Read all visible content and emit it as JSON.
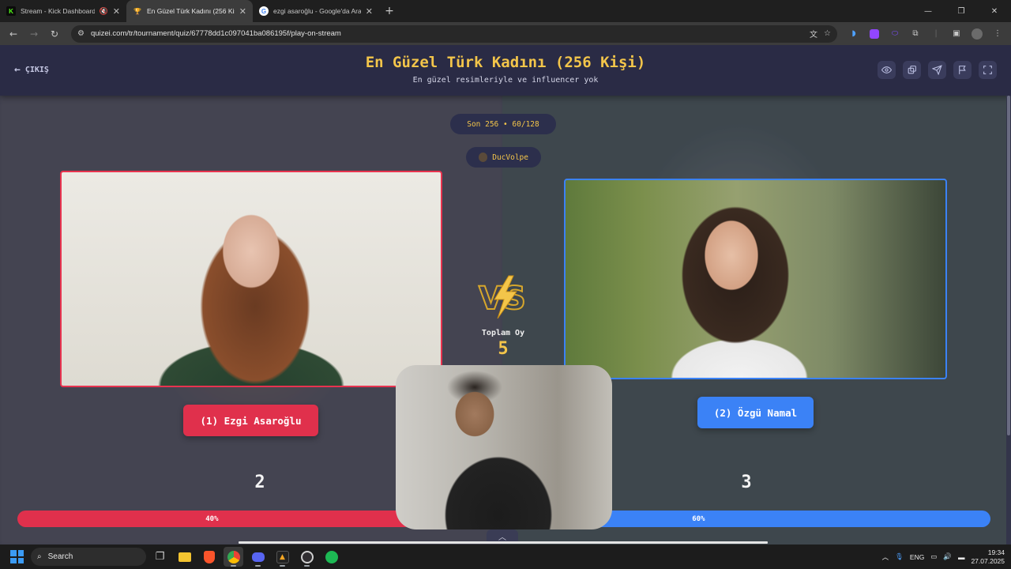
{
  "browser": {
    "tabs": [
      {
        "title": "Stream - Kick Dashboard",
        "favicon": "K",
        "favicon_color": "#53fc18",
        "muted": true,
        "active": false
      },
      {
        "title": "En Güzel Türk Kadını (256 Kişi)",
        "favicon": "🏆",
        "favicon_color": "#f3c54a",
        "muted": false,
        "active": true
      },
      {
        "title": "ezgi asaroğlu - Google'da Ara",
        "favicon": "G",
        "favicon_color": "#ffffff",
        "muted": false,
        "active": false
      }
    ],
    "url": "quizei.com/tr/tournament/quiz/67778dd1c097041ba086195f/play-on-stream"
  },
  "header": {
    "back_label": "ÇIKIŞ",
    "title": "En Güzel Türk Kadını (256 Kişi)",
    "subtitle": "En güzel resimleriyle ve influencer yok",
    "icons": [
      "eye-icon",
      "share-icon",
      "send-icon",
      "flag-icon",
      "fullscreen-icon"
    ]
  },
  "round": {
    "label": "Son 256 • 60/128",
    "user": "DucVolpe"
  },
  "contestants": {
    "left": {
      "label": "(1) Ezgi Asaroğlu",
      "votes": "2",
      "percent_label": "40%",
      "percent": 40,
      "color": "#e0304c"
    },
    "right": {
      "label": "(2) Özgü Namal",
      "votes": "3",
      "percent_label": "60%",
      "percent": 60,
      "color": "#3b82f6"
    }
  },
  "total": {
    "label": "Toplam Oy",
    "value": "5"
  },
  "taskbar": {
    "search_placeholder": "Search",
    "language": "ENG",
    "time": "19:34",
    "date": "27.07.2025"
  },
  "colors": {
    "accent": "#f3c54a",
    "header_bg": "#2a2b45",
    "left": "#e0304c",
    "right": "#3b82f6"
  }
}
